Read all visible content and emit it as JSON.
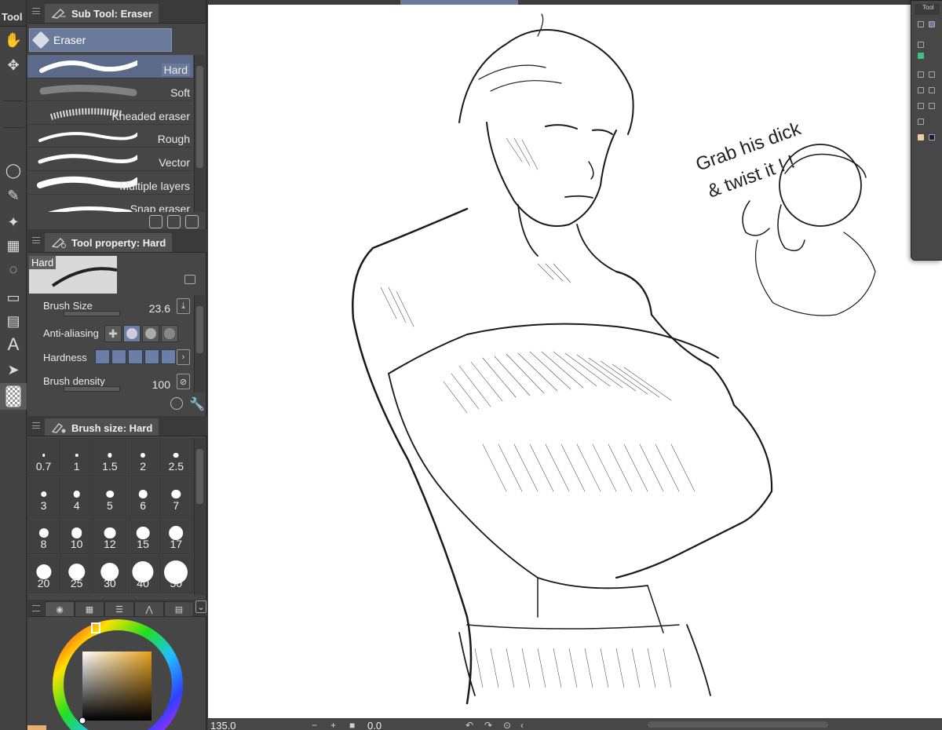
{
  "toolbar": {
    "title": "Tool",
    "icons": [
      "hand-icon",
      "move-icon",
      "lasso-icon",
      "eyedropper-icon",
      "sparkle-icon",
      "grid-icon",
      "lasso-fill-icon",
      "gradient-icon",
      "frame-icon",
      "text-icon",
      "select-arrow-icon",
      "transparent-color-icon"
    ]
  },
  "subtool": {
    "header": "Sub Tool: Eraser",
    "group_tab": "Eraser",
    "items": [
      {
        "label": "Hard",
        "selected": true
      },
      {
        "label": "Soft",
        "selected": false
      },
      {
        "label": "Kneaded eraser",
        "selected": false
      },
      {
        "label": "Rough",
        "selected": false
      },
      {
        "label": "Vector",
        "selected": false
      },
      {
        "label": "Multiple layers",
        "selected": false
      },
      {
        "label": "Snap eraser",
        "selected": false
      }
    ]
  },
  "tool_property": {
    "header": "Tool property: Hard",
    "preview_name": "Hard",
    "brush_size_label": "Brush Size",
    "brush_size_value": "23.6",
    "antialiasing_label": "Anti-aliasing",
    "hardness_label": "Hardness",
    "density_label": "Brush density",
    "density_value": "100"
  },
  "brush_size": {
    "header": "Brush size: Hard",
    "sizes": [
      "0.7",
      "1",
      "1.5",
      "2",
      "2.5",
      "3",
      "4",
      "5",
      "6",
      "7",
      "8",
      "10",
      "12",
      "15",
      "17",
      "20",
      "25",
      "30",
      "40",
      "50"
    ]
  },
  "status": {
    "zoom": "135.0",
    "angle": "0.0"
  },
  "canvas": {
    "doodle_text_line1": "Grab his dick",
    "doodle_text_line2": "& twist it ! !"
  },
  "colors": {
    "accent": "#6d7ea6",
    "main_color": "#e8a21a"
  }
}
